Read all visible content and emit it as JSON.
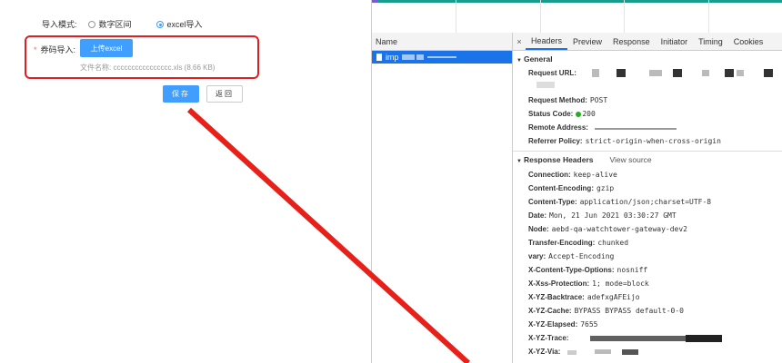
{
  "form": {
    "mode_label": "导入模式:",
    "radio_number_range": "数字区间",
    "radio_excel": "excel导入",
    "coupon_label": "券码导入:",
    "required_star": "*",
    "upload_button": "上传excel",
    "file_name": "文件名称: cccccccccccccccc.xls  (8.66 KB)",
    "save_button": "保存",
    "back_button": "返回"
  },
  "devtools": {
    "name_header": "Name",
    "request_name": "imp",
    "tabs": [
      "Headers",
      "Preview",
      "Response",
      "Initiator",
      "Timing",
      "Cookies"
    ],
    "active_tab": "Headers",
    "close_symbol": "×",
    "general_title": "General",
    "general": {
      "request_url_key": "Request URL:",
      "method_key": "Request Method:",
      "method_val": "POST",
      "status_key": "Status Code:",
      "status_val": "200",
      "remote_key": "Remote Address:",
      "remote_val": "",
      "referrer_key": "Referrer Policy:",
      "referrer_val": "strict-origin-when-cross-origin"
    },
    "response_title": "Response Headers",
    "view_source": "View source",
    "response_headers": [
      {
        "k": "Connection:",
        "v": "keep-alive"
      },
      {
        "k": "Content-Encoding:",
        "v": "gzip"
      },
      {
        "k": "Content-Type:",
        "v": "application/json;charset=UTF-8"
      },
      {
        "k": "Date:",
        "v": "Mon, 21 Jun 2021 03:30:27 GMT"
      },
      {
        "k": "Node:",
        "v": "aebd-qa-watchtower-gateway-dev2"
      },
      {
        "k": "Transfer-Encoding:",
        "v": "chunked"
      },
      {
        "k": "vary:",
        "v": "Accept-Encoding"
      },
      {
        "k": "X-Content-Type-Options:",
        "v": "nosniff"
      },
      {
        "k": "X-Xss-Protection:",
        "v": "1; mode=block"
      },
      {
        "k": "X-YZ-Backtrace:",
        "v": "adefxgAFEijo"
      },
      {
        "k": "X-YZ-Cache:",
        "v": "BYPASS BYPASS default-0-0"
      },
      {
        "k": "X-YZ-Elapsed:",
        "v": "7655"
      },
      {
        "k": "X-YZ-Trace:",
        "v": ""
      },
      {
        "k": "X-YZ-Via:",
        "v": ""
      }
    ]
  },
  "colors": {
    "primary": "#409eff",
    "highlight": "#e02020",
    "selected_row": "#1a73e8",
    "status_ok": "#20b020"
  }
}
